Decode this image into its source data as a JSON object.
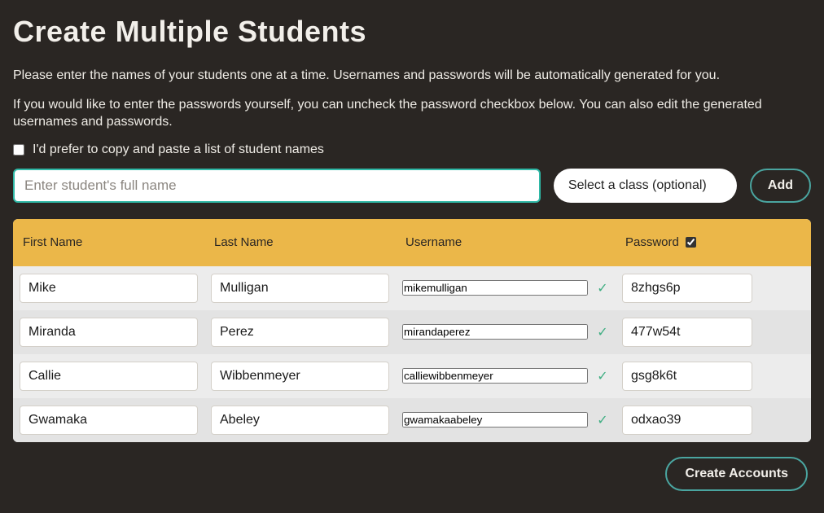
{
  "title": "Create Multiple Students",
  "instructions": {
    "p1": "Please enter the names of your students one at a time. Usernames and passwords will be automatically generated for you.",
    "p2": "If you would like to enter the passwords yourself, you can uncheck the password checkbox below. You can also edit the generated usernames and passwords."
  },
  "preference": {
    "checked": false,
    "label": "I'd prefer to copy and paste a list of student names"
  },
  "name_input": {
    "placeholder": "Enter student's full name",
    "value": ""
  },
  "class_select": {
    "label": "Select a class (optional)"
  },
  "add_button": "Add",
  "table": {
    "headers": {
      "first": "First Name",
      "last": "Last Name",
      "username": "Username",
      "password": "Password",
      "password_checked": true
    },
    "rows": [
      {
        "first": "Mike",
        "last": "Mulligan",
        "username": "mikemulligan",
        "valid": true,
        "password": "8zhgs6p"
      },
      {
        "first": "Miranda",
        "last": "Perez",
        "username": "mirandaperez",
        "valid": true,
        "password": "477w54t"
      },
      {
        "first": "Callie",
        "last": "Wibbenmeyer",
        "username": "calliewibbenmeyer",
        "valid": true,
        "password": "gsg8k6t"
      },
      {
        "first": "Gwamaka",
        "last": "Abeley",
        "username": "gwamakaabeley",
        "valid": true,
        "password": "odxao39"
      }
    ]
  },
  "create_button": "Create Accounts"
}
